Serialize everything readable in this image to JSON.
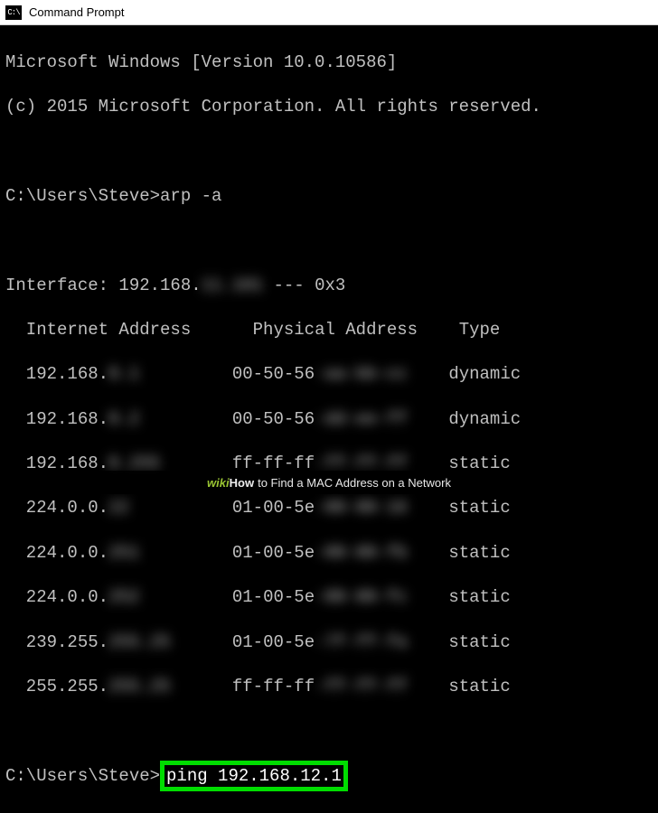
{
  "window": {
    "title": "Command Prompt",
    "icon_glyph": "C:\\"
  },
  "output": {
    "version_line": "Microsoft Windows [Version 10.0.10586]",
    "copyright_line": "(c) 2015 Microsoft Corporation. All rights reserved.",
    "prompt1_path": "C:\\Users\\Steve>",
    "command1": "arp -a",
    "interface_prefix": "Interface: 192.168.",
    "interface_blur": "11.101",
    "interface_suffix": " --- 0x3",
    "header_internet": "  Internet Address",
    "header_physical": "Physical Address",
    "header_type": "Type",
    "rows": [
      {
        "ip": "  192.168.",
        "ip_blur": "0.1   ",
        "mac": "00-50-56",
        "mac_blur": "-aa-bb-cc",
        "type": "dynamic"
      },
      {
        "ip": "  192.168.",
        "ip_blur": "0.2   ",
        "mac": "00-50-56",
        "mac_blur": "-dd-ee-ff",
        "type": "dynamic"
      },
      {
        "ip": "  192.168.",
        "ip_blur": "0.255 ",
        "mac": "ff-ff-ff",
        "mac_blur": "-ff-ff-ff",
        "type": "static"
      },
      {
        "ip": "  224.0.0.",
        "ip_blur": "22    ",
        "mac": "01-00-5e",
        "mac_blur": "-00-00-16",
        "type": "static"
      },
      {
        "ip": "  224.0.0.",
        "ip_blur": "251   ",
        "mac": "01-00-5e",
        "mac_blur": "-00-00-fb",
        "type": "static"
      },
      {
        "ip": "  224.0.0.",
        "ip_blur": "252   ",
        "mac": "01-00-5e",
        "mac_blur": "-00-00-fc",
        "type": "static"
      },
      {
        "ip": "  239.255.",
        "ip_blur": "255.25",
        "mac": "01-00-5e",
        "mac_blur": "-7f-ff-fa",
        "type": "static"
      },
      {
        "ip": "  255.255.",
        "ip_blur": "255.25",
        "mac": "ff-ff-ff",
        "mac_blur": "-ff-ff-ff",
        "type": "static"
      }
    ],
    "prompt2_path": "C:\\Users\\Steve>",
    "command2": "ping 192.168.12.1"
  },
  "caption": {
    "logo_a": "wiki",
    "logo_b": "How",
    "text": " to Find a MAC Address on a Network"
  },
  "spacing": {
    "col1_pad": "      ",
    "col2_pad": "    ",
    "hdr_col2_pad": "    "
  }
}
